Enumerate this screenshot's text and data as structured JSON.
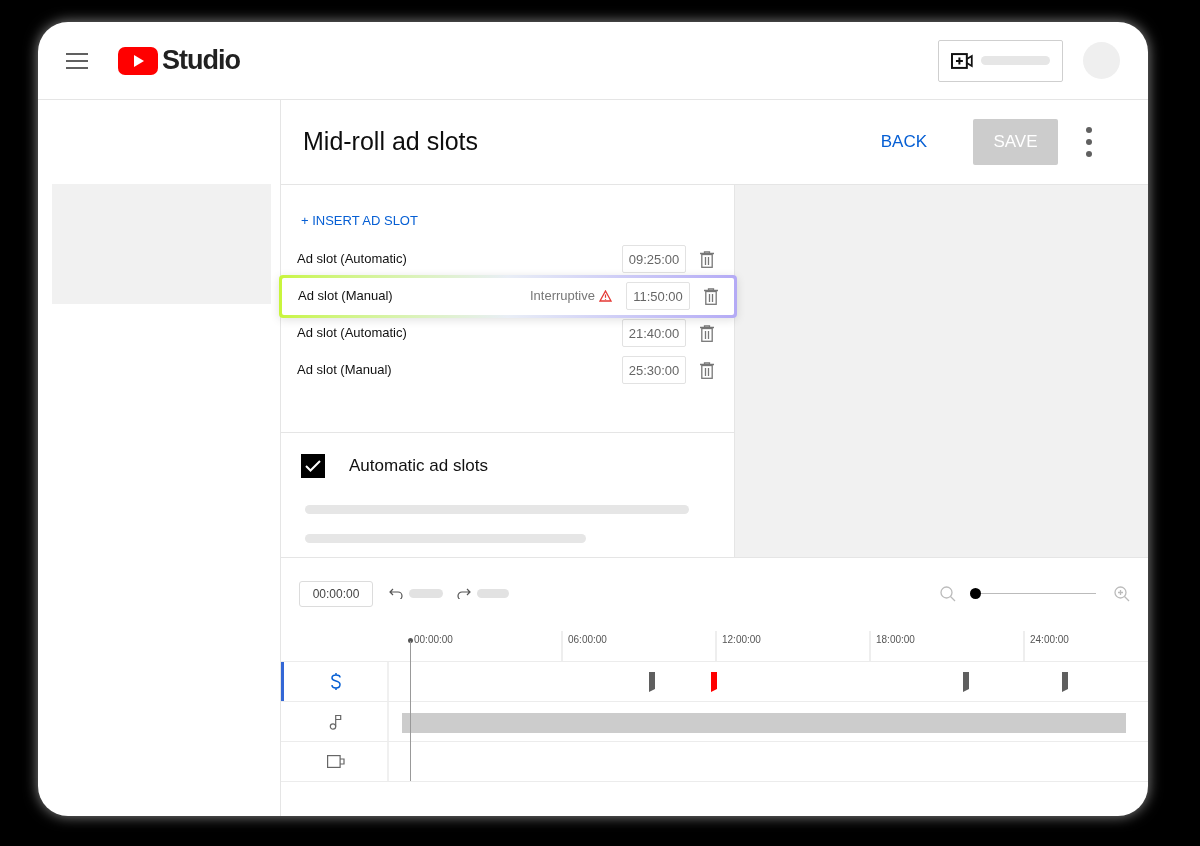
{
  "header": {
    "logo_text": "Studio"
  },
  "page": {
    "title": "Mid-roll ad slots",
    "back": "BACK",
    "save": {
      "label": "SAVE",
      "disabled": true
    }
  },
  "insert_button": "+ INSERT AD SLOT",
  "slots": [
    {
      "label": "Ad slot (Automatic)",
      "time": "09:25:00",
      "highlighted": false
    },
    {
      "label": "Ad slot (Manual)",
      "note": "Interruptive",
      "warning": true,
      "time": "11:50:00",
      "highlighted": true
    },
    {
      "label": "Ad slot (Automatic)",
      "time": "21:40:00",
      "highlighted": false
    },
    {
      "label": "Ad slot (Manual)",
      "time": "25:30:00",
      "highlighted": false
    }
  ],
  "automatic": {
    "label": "Automatic ad slots",
    "checked": true
  },
  "timeline": {
    "time": "00:00:00",
    "zoom": {
      "level": 0
    },
    "ticks": [
      "00:00:00",
      "06:00:00",
      "12:00:00",
      "18:00:00",
      "24:00:00"
    ],
    "tracks": [
      {
        "kind": "ads",
        "selected": true
      },
      {
        "kind": "audio",
        "selected": false
      },
      {
        "kind": "video",
        "selected": false
      }
    ]
  }
}
